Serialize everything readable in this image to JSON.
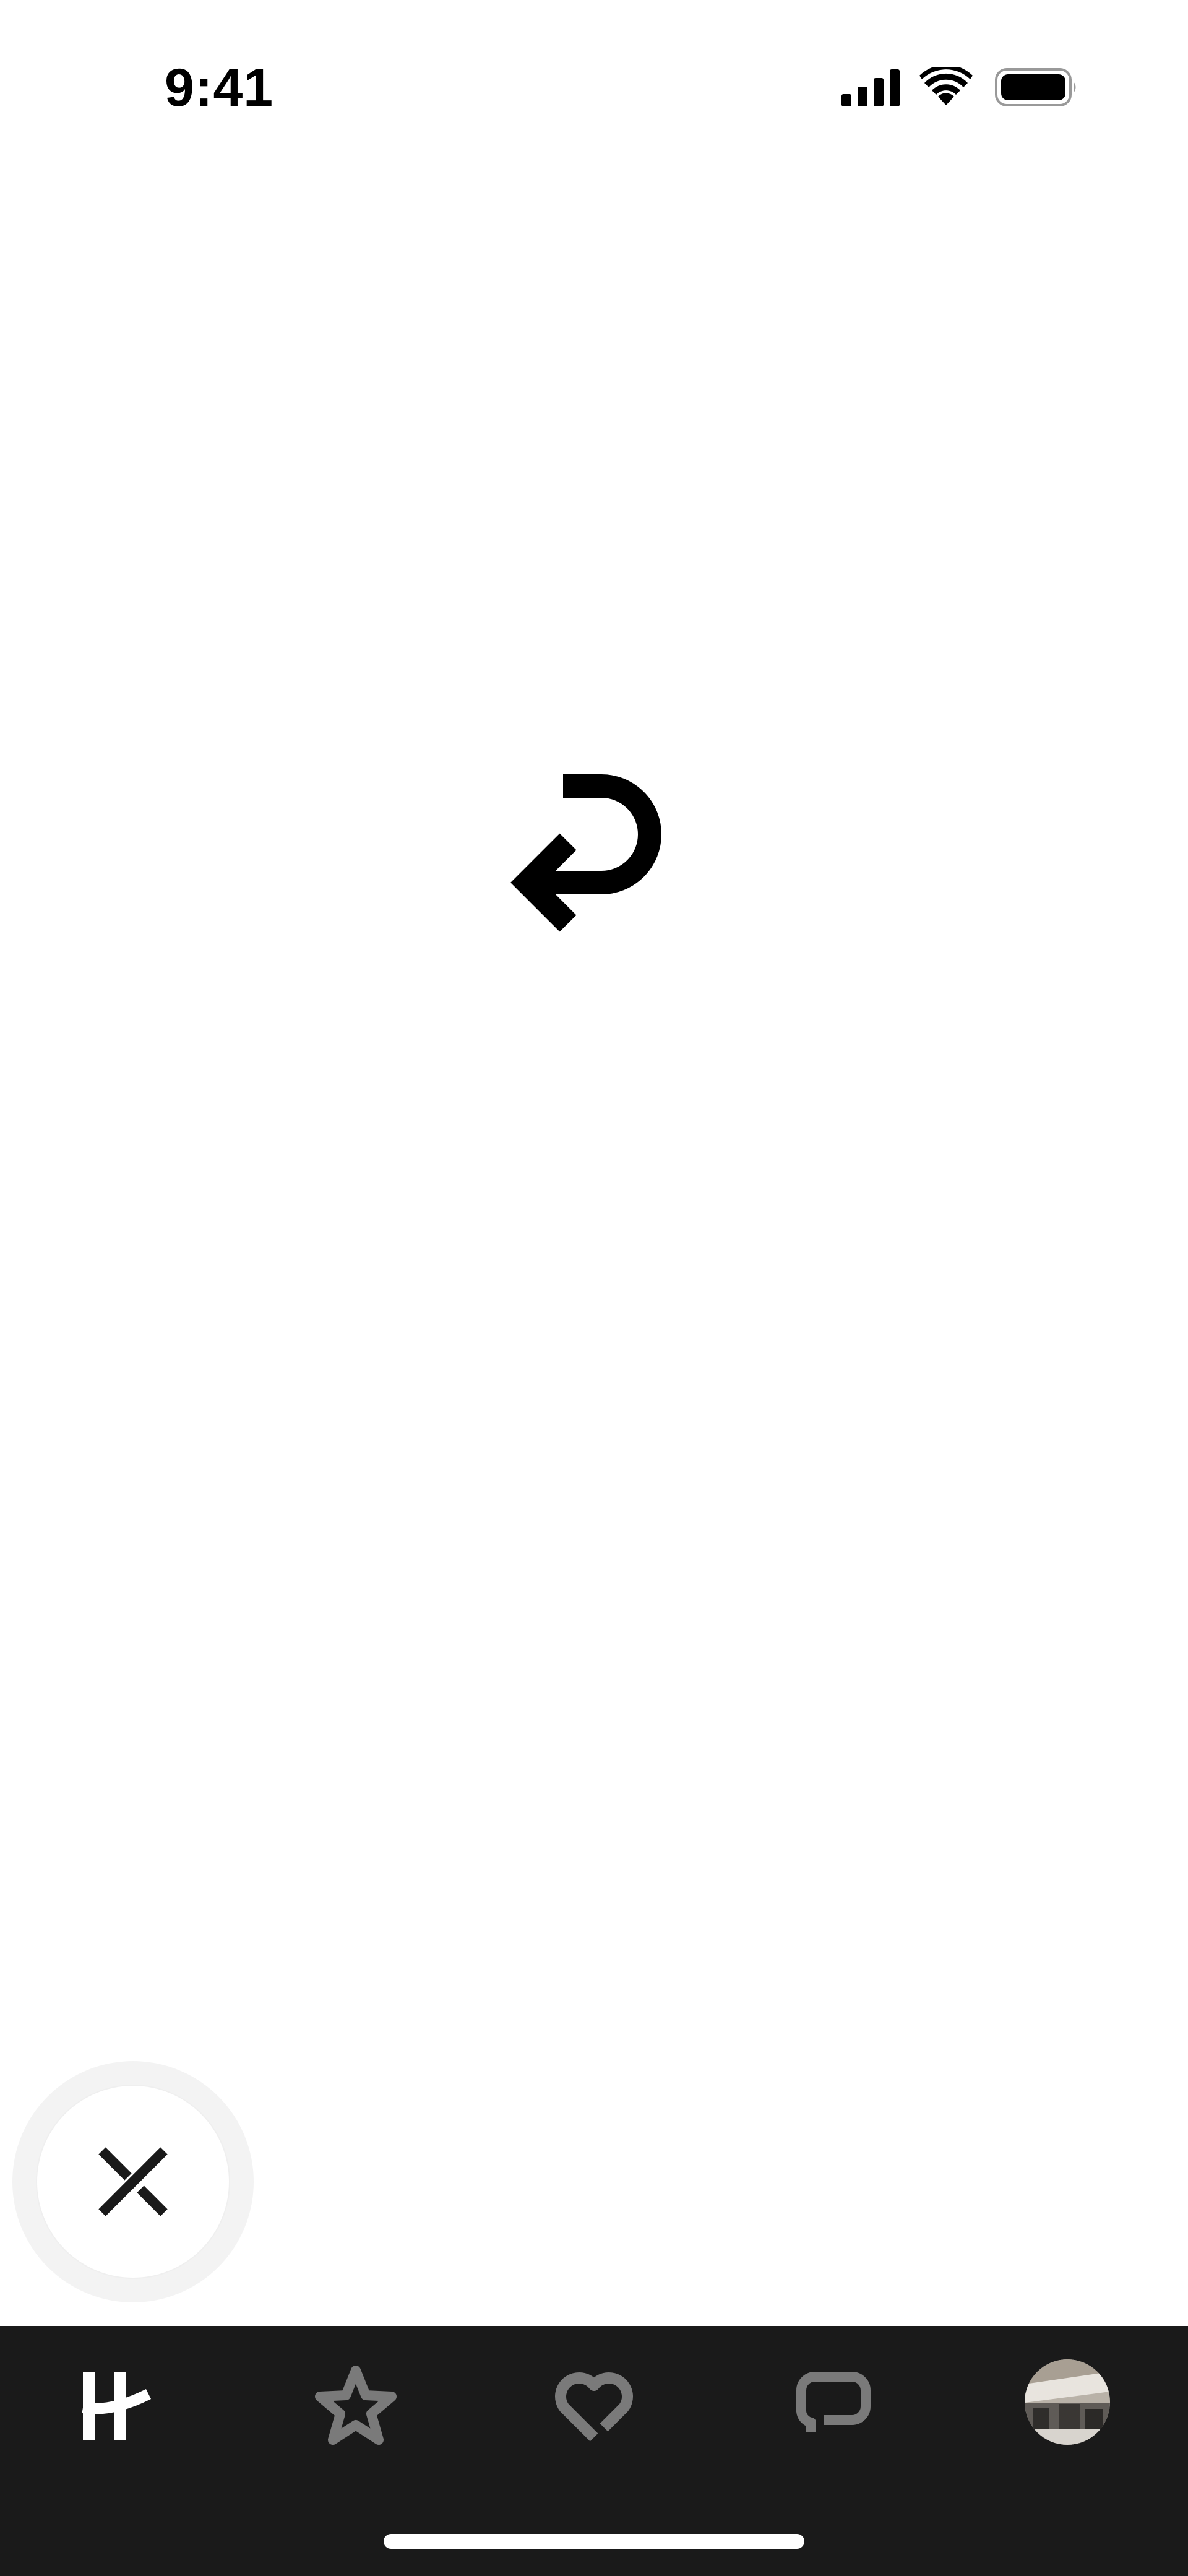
{
  "status_bar": {
    "time": "9:41"
  },
  "center": {
    "icon": "undo-arrow-icon"
  },
  "fab": {
    "icon": "close-icon"
  },
  "tab_bar": {
    "background": "#1a1a1a",
    "active_color": "#ffffff",
    "inactive_color": "#7a7a7a",
    "tabs": [
      {
        "icon": "hinge-logo-icon",
        "active": true
      },
      {
        "icon": "star-icon",
        "active": false
      },
      {
        "icon": "heart-icon",
        "active": false
      },
      {
        "icon": "chat-bubble-icon",
        "active": false
      },
      {
        "icon": "profile-avatar",
        "active": false
      }
    ]
  }
}
